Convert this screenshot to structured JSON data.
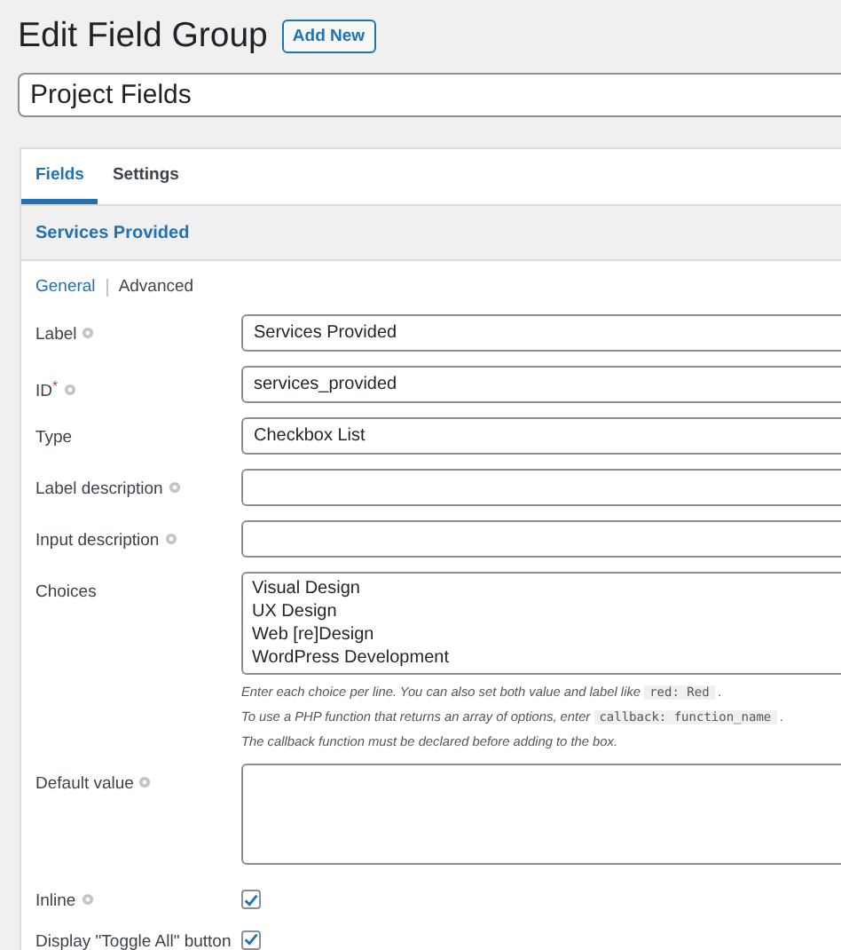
{
  "header": {
    "title": "Edit Field Group",
    "add_button": "Add New"
  },
  "group_title": {
    "value": "Project Fields"
  },
  "tabs": [
    {
      "label": "Fields",
      "selected": true
    },
    {
      "label": "Settings",
      "selected": false
    }
  ],
  "field": {
    "name": "Services Provided"
  },
  "subtabs": [
    {
      "label": "General",
      "selected": true
    },
    {
      "label": "Advanced",
      "selected": false
    }
  ],
  "rows": [
    {
      "kind": "text",
      "label": "Label",
      "help": true,
      "value": "Services Provided"
    },
    {
      "kind": "text",
      "label": "ID",
      "required_mark": "*",
      "help": true,
      "value": "services_provided"
    },
    {
      "kind": "select",
      "label": "Type",
      "help": false,
      "value": "Checkbox List"
    },
    {
      "kind": "text",
      "label": "Label description",
      "help": true
    },
    {
      "kind": "text",
      "label": "Input description",
      "help": true
    },
    {
      "kind": "textarea",
      "label": "Choices",
      "help": false,
      "lines": [
        "Visual Design",
        "UX Design",
        "Web [re]Design",
        "WordPress Development"
      ],
      "description": [
        [
          {
            "kind": "text",
            "text": "Enter each choice per line. You can also set both value and label like"
          },
          {
            "kind": "code",
            "text": "red: Red"
          },
          {
            "kind": "text",
            "text": "."
          }
        ],
        [
          {
            "kind": "text",
            "text": "To use a PHP function that returns an array of options, enter"
          },
          {
            "kind": "code",
            "text": "callback: function_name"
          },
          {
            "kind": "text",
            "text": "."
          }
        ],
        [
          {
            "kind": "text",
            "text": "The callback function must be declared before adding to the box."
          }
        ]
      ]
    },
    {
      "kind": "textarea",
      "label": "Default value",
      "help": true,
      "lines": []
    },
    {
      "kind": "checkbox",
      "label": "Inline",
      "help": true,
      "checked": true
    },
    {
      "kind": "checkbox",
      "label": "Display \"Toggle All\" button",
      "help": false,
      "checked": true
    }
  ]
}
